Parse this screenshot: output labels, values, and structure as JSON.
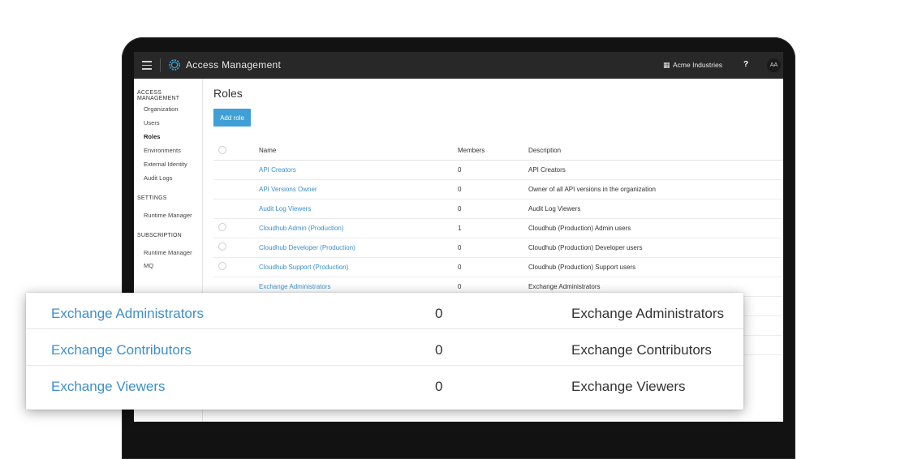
{
  "app": {
    "title": "Access Management",
    "org_name": "Acme Industries",
    "help_label": "?",
    "avatar_initials": "AA"
  },
  "sidebar": {
    "sections": [
      {
        "heading": "ACCESS MANAGEMENT",
        "items": [
          "Organization",
          "Users",
          "Roles",
          "Environments",
          "External Identity",
          "Audit Logs"
        ]
      },
      {
        "heading": "SETTINGS",
        "items": [
          "Runtime Manager"
        ]
      },
      {
        "heading": "SUBSCRIPTION",
        "items": [
          "Runtime Manager",
          "MQ"
        ]
      }
    ],
    "active_item": "Roles"
  },
  "main": {
    "title": "Roles",
    "add_button": "Add role"
  },
  "table": {
    "columns": [
      "Name",
      "Members",
      "Description"
    ],
    "rows": [
      {
        "name": "API Creators",
        "members": "0",
        "description": "API Creators",
        "checkbox": false
      },
      {
        "name": "API Versions Owner",
        "members": "0",
        "description": "Owner of all API versions in the organization",
        "checkbox": false
      },
      {
        "name": "Audit Log Viewers",
        "members": "0",
        "description": "Audit Log Viewers",
        "checkbox": false
      },
      {
        "name": "Cloudhub Admin (Production)",
        "members": "1",
        "description": "Cloudhub (Production) Admin users",
        "checkbox": true
      },
      {
        "name": "Cloudhub Developer (Production)",
        "members": "0",
        "description": "Cloudhub (Production) Developer users",
        "checkbox": true
      },
      {
        "name": "Cloudhub Support (Production)",
        "members": "0",
        "description": "Cloudhub (Production) Support users",
        "checkbox": true
      },
      {
        "name": "Exchange Administrators",
        "members": "0",
        "description": "Exchange Administrators",
        "checkbox": false
      }
    ]
  },
  "zoom": {
    "rows": [
      {
        "name": "Exchange Administrators",
        "members": "0",
        "description": "Exchange Administrators"
      },
      {
        "name": "Exchange Contributors",
        "members": "0",
        "description": "Exchange Contributors"
      },
      {
        "name": "Exchange Viewers",
        "members": "0",
        "description": "Exchange Viewers"
      }
    ]
  },
  "colors": {
    "accent": "#3f9fd6",
    "link": "#3d8fca",
    "topbar": "#282828"
  },
  "icons": {
    "menu": "hamburger-menu-icon",
    "logo": "gear-icon",
    "org": "building-icon"
  }
}
